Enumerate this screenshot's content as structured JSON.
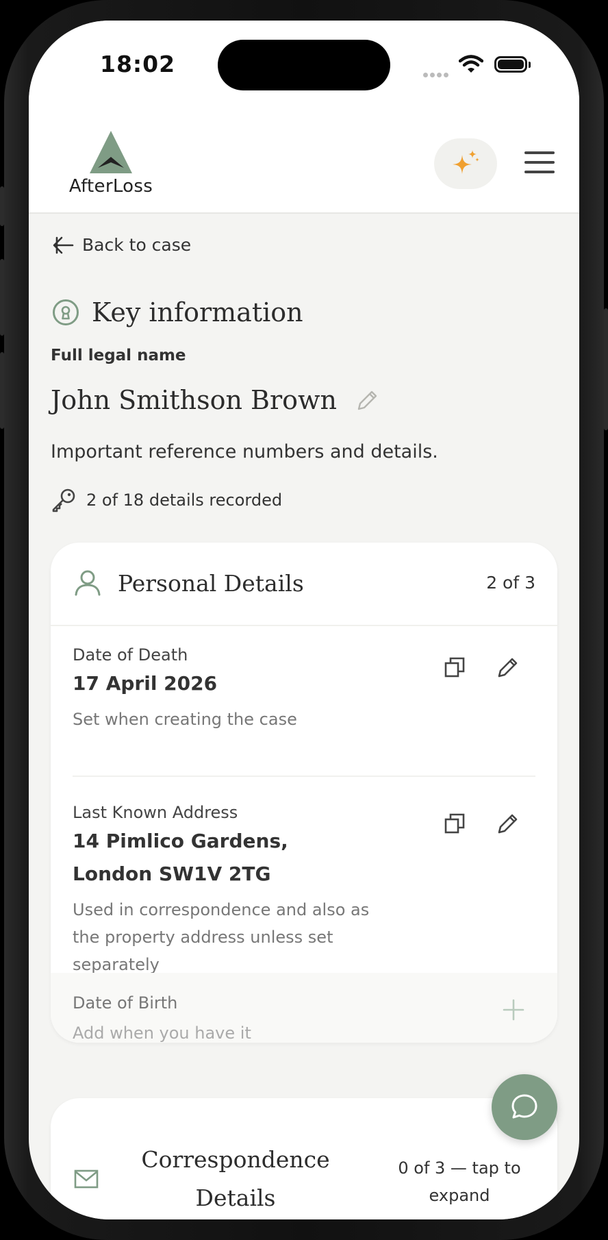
{
  "status_bar": {
    "time": "18:02"
  },
  "header": {
    "logo_text": "AfterLoss",
    "ai_button_icon": "sparkles-icon",
    "menu_icon": "hamburger-menu-icon"
  },
  "back_link": {
    "label": "Back to case"
  },
  "page": {
    "title": "Key information",
    "full_name_label": "Full legal name",
    "full_name": "John Smithson Brown",
    "subtitle": "Important reference numbers and details.",
    "progress": "2 of 18 details recorded"
  },
  "personal_details": {
    "title": "Personal Details",
    "count": "2 of 3",
    "items": [
      {
        "label": "Date of Death",
        "value": "17 April 2026",
        "note": "Set when creating the case"
      },
      {
        "label": "Last Known Address",
        "value": "14 Pimlico Gardens, London SW1V 2TG",
        "note": "Used in correspondence and also as the property address unless set separately"
      }
    ],
    "empty_item": {
      "label": "Date of Birth",
      "hint": "Add when you have it"
    }
  },
  "correspondence_details": {
    "title": "Correspondence Details",
    "count": "0 of 3 — tap to expand"
  },
  "colors": {
    "brand_green": "#7f9c85",
    "accent_orange": "#f0a030",
    "background": "#f4f4f2"
  }
}
